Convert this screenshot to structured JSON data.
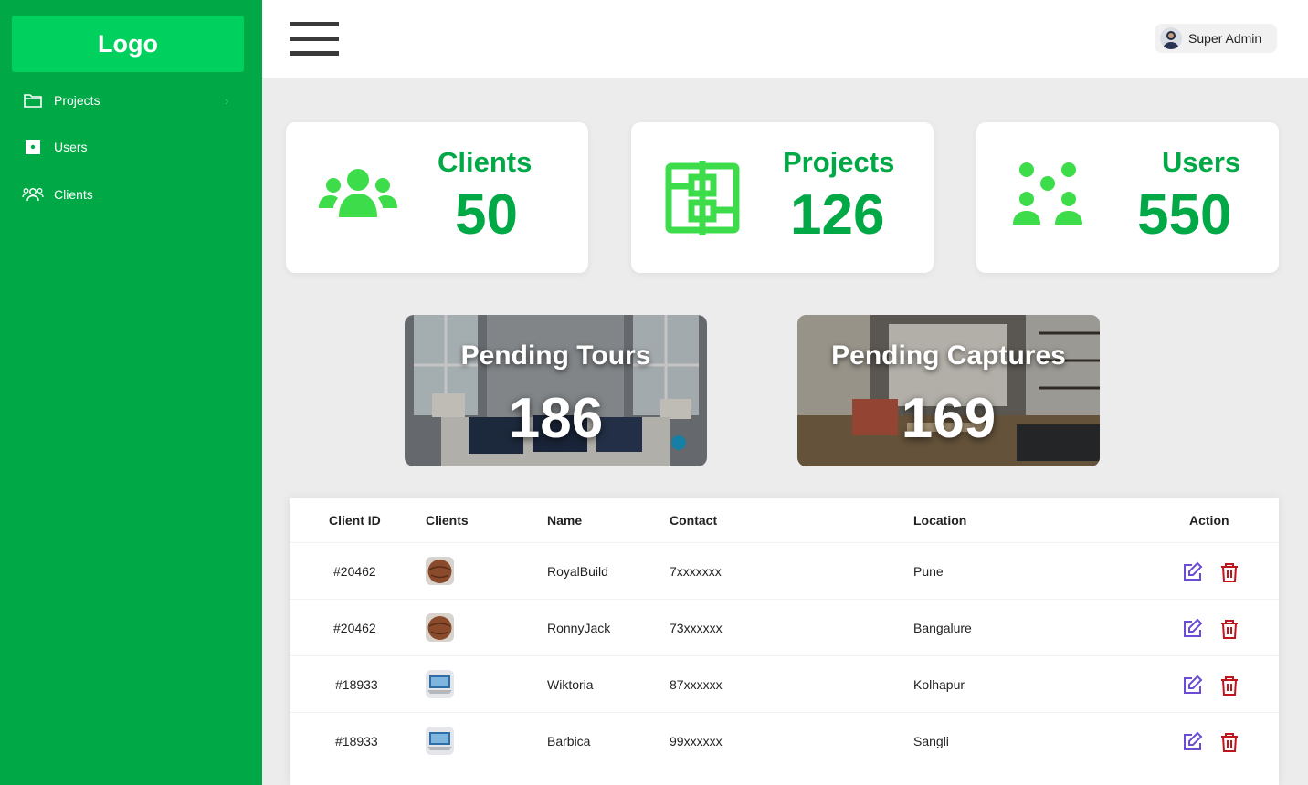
{
  "sidebar": {
    "logo": "Logo",
    "items": [
      {
        "label": "Projects",
        "icon": "folder-icon",
        "has_chevron": true
      },
      {
        "label": "Users",
        "icon": "user-square-icon"
      },
      {
        "label": "Clients",
        "icon": "people-icon"
      }
    ],
    "chevron": "›"
  },
  "header": {
    "user_name": "Super Admin"
  },
  "stats": [
    {
      "title": "Clients",
      "value": "50",
      "icon": "group-icon"
    },
    {
      "title": "Projects",
      "value": "126",
      "icon": "blueprint-icon"
    },
    {
      "title": "Users",
      "value": "550",
      "icon": "users-grid-icon"
    }
  ],
  "photo_cards": [
    {
      "title": "Pending Tours",
      "value": "186"
    },
    {
      "title": "Pending Captures",
      "value": "169"
    }
  ],
  "table": {
    "columns": [
      "Client ID",
      "Clients",
      "Name",
      "Contact",
      "Location",
      "Action"
    ],
    "rows": [
      {
        "id": "#20462",
        "name": "RoyalBuild",
        "contact": "7xxxxxxx",
        "location": "Pune",
        "thumb": "leather-ball"
      },
      {
        "id": "#20462",
        "name": "RonnyJack",
        "contact": "73xxxxxx",
        "location": "Bangalure",
        "thumb": "leather-ball"
      },
      {
        "id": "#18933",
        "name": "Wiktoria",
        "contact": "87xxxxxx",
        "location": "Kolhapur",
        "thumb": "laptop"
      },
      {
        "id": "#18933",
        "name": "Barbica",
        "contact": "99xxxxxx",
        "location": "Sangli",
        "thumb": "laptop"
      }
    ]
  },
  "colors": {
    "sidebar": "#00a846",
    "logo_bg": "#00d15e",
    "accent": "#00a846",
    "icon_green": "#3ddc4b",
    "edit": "#6a4cd6",
    "delete": "#c0131b"
  }
}
